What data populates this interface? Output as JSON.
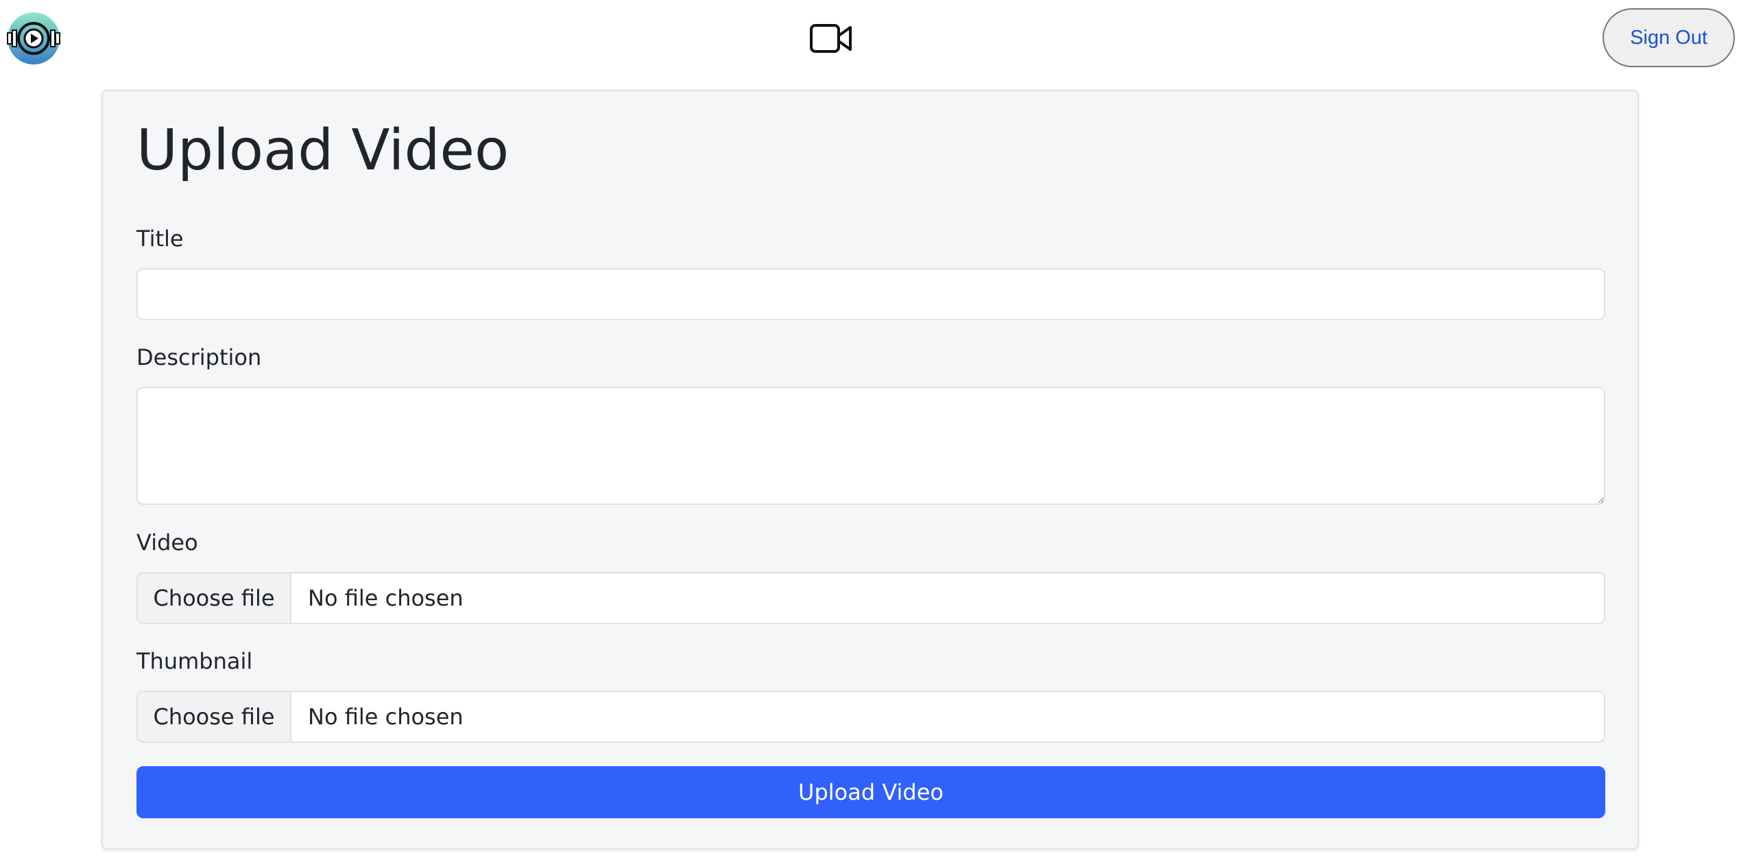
{
  "header": {
    "logo_icon": "fitness-video-logo-icon",
    "video_icon": "video-camera-icon",
    "sign_out_label": "Sign Out"
  },
  "form": {
    "heading": "Upload Video",
    "title_label": "Title",
    "title_value": "",
    "description_label": "Description",
    "description_value": "",
    "video_label": "Video",
    "video_choose_label": "Choose file",
    "video_status": "No file chosen",
    "thumbnail_label": "Thumbnail",
    "thumbnail_choose_label": "Choose file",
    "thumbnail_status": "No file chosen",
    "submit_label": "Upload Video"
  },
  "colors": {
    "primary": "#3160fb",
    "card_background": "#f5f6f8",
    "sign_out_text": "#1a4ed8"
  }
}
